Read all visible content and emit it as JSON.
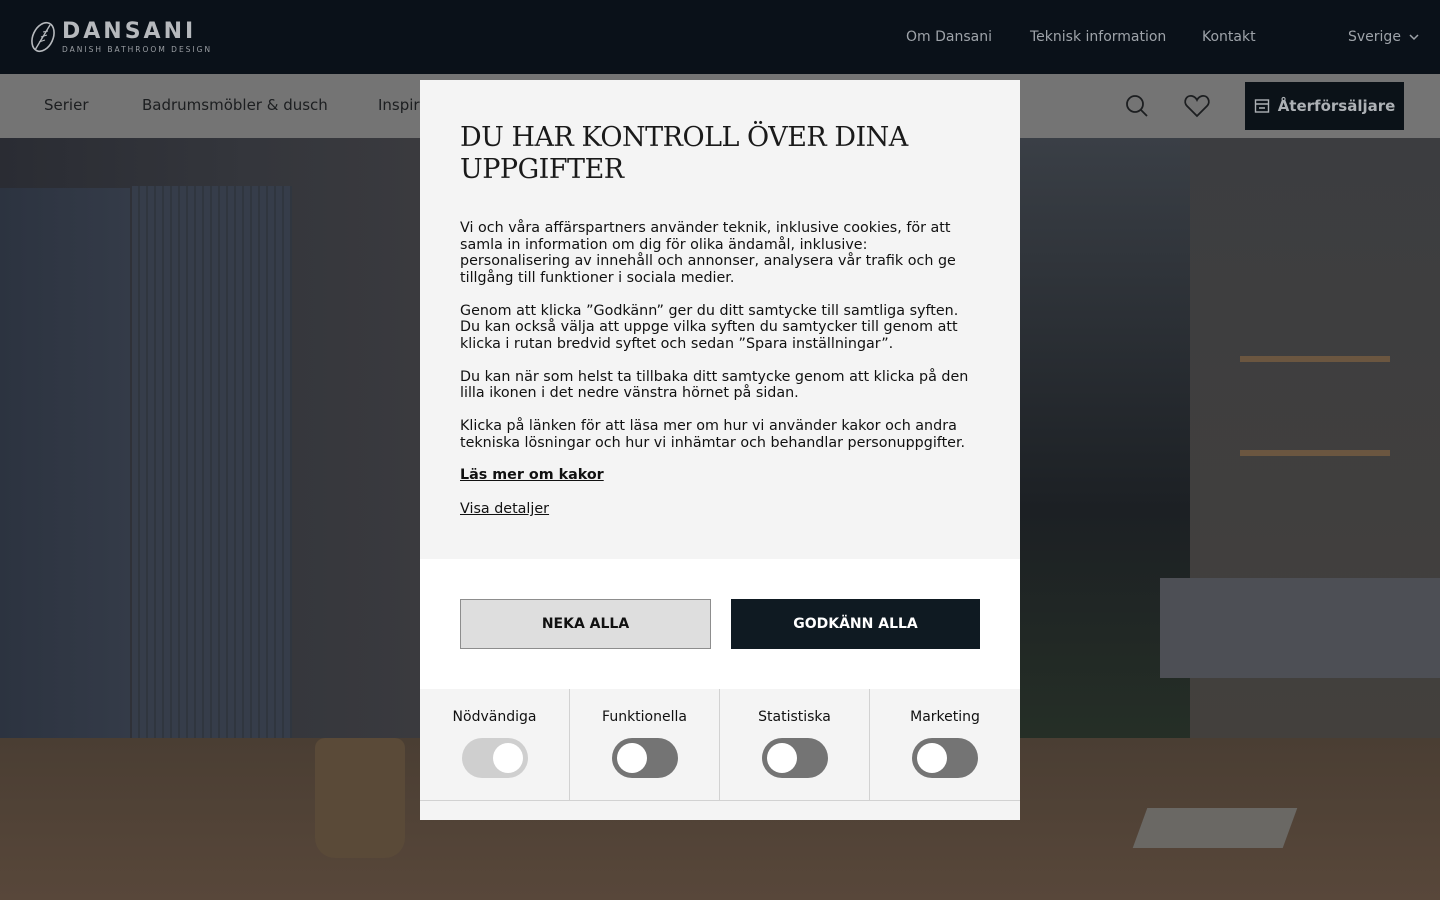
{
  "header": {
    "brand": "DANSANI",
    "tagline": "DANISH BATHROOM DESIGN",
    "links": [
      "Om Dansani",
      "Teknisk information",
      "Kontakt"
    ],
    "country": "Sverige"
  },
  "nav": {
    "items": [
      "Serier",
      "Badrumsmöbler & dusch",
      "Inspira"
    ],
    "dealer_button": "Återförsäljare"
  },
  "consent": {
    "title": "DU HAR KONTROLL ÖVER DINA UPPGIFTER",
    "paragraphs": [
      "Vi och våra affärspartners använder teknik, inklusive cookies, för att samla in information om dig för olika ändamål, inklusive: personalisering av innehåll och annonser, analysera vår trafik och ge tillgång till funktioner i sociala medier.",
      "Genom att klicka ”Godkänn” ger du ditt samtycke till samtliga syften. Du kan också välja att uppge vilka syften du samtycker till genom att klicka i rutan bredvid syftet och sedan ”Spara inställningar”.",
      "Du kan när som helst ta tillbaka ditt samtycke genom att klicka på den lilla ikonen i det nedre vänstra hörnet på sidan.",
      "Klicka på länken för att läsa mer om hur vi använder kakor och andra tekniska lösningar och hur vi inhämtar och behandlar personuppgifter."
    ],
    "read_more_link": "Läs mer om kakor",
    "details_link": "Visa detaljer",
    "deny_button": "NEKA ALLA",
    "accept_button": "GODKÄNN ALLA",
    "toggles": [
      {
        "label": "Nödvändiga",
        "state": "on-disabled"
      },
      {
        "label": "Funktionella",
        "state": "off"
      },
      {
        "label": "Statistiska",
        "state": "off"
      },
      {
        "label": "Marketing",
        "state": "off"
      }
    ]
  },
  "colors": {
    "topbar": "#0a1119",
    "navbar_dimmed": "#747474",
    "accept_button": "#0f1a22",
    "modal_bg": "#f4f4f4"
  }
}
